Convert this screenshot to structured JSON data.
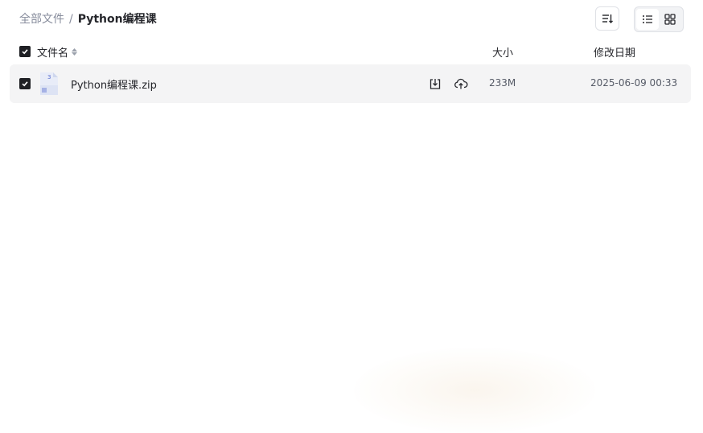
{
  "breadcrumb": {
    "root": "全部文件",
    "separator": "/",
    "current": "Python编程课"
  },
  "toolbar": {
    "sort_icon": "sort-icon",
    "view_modes": [
      "list-view-icon",
      "grid-view-icon"
    ],
    "active_view": "list"
  },
  "list_header": {
    "name": "文件名",
    "size": "大小",
    "date": "修改日期"
  },
  "files": [
    {
      "name": "Python编程课.zip",
      "size": "233M",
      "modified": "2025-06-09 00:33",
      "checked": true,
      "icon": "zip-file-icon"
    }
  ],
  "colors": {
    "text": "#25262b",
    "muted": "#878c9c",
    "row_bg": "#f4f4f5",
    "checkbox": "#1f2024",
    "border": "#dfe1e6"
  }
}
